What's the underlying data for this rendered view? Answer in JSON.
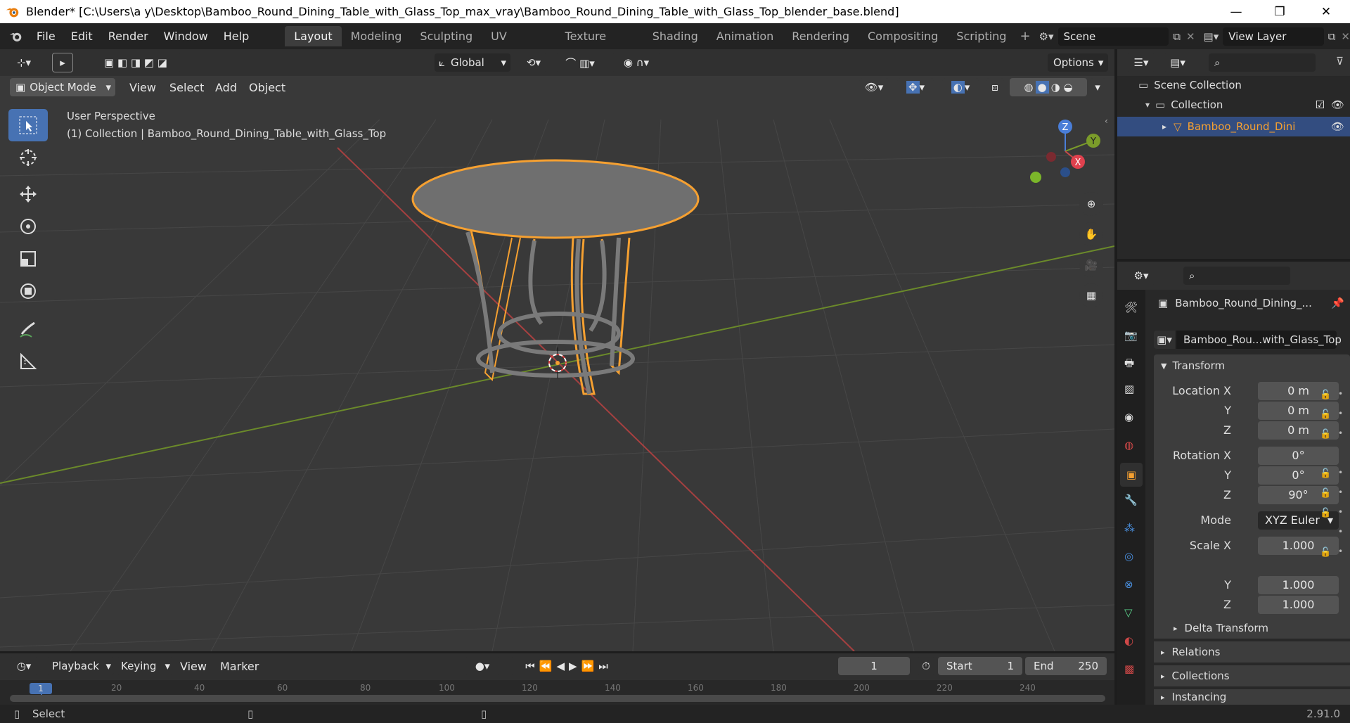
{
  "window": {
    "title": "Blender* [C:\\Users\\a y\\Desktop\\Bamboo_Round_Dining_Table_with_Glass_Top_max_vray\\Bamboo_Round_Dining_Table_with_Glass_Top_blender_base.blend]",
    "minimize": "—",
    "maximize": "❐",
    "close": "✕"
  },
  "menu": [
    "File",
    "Edit",
    "Render",
    "Window",
    "Help"
  ],
  "workspaces": [
    "Layout",
    "Modeling",
    "Sculpting",
    "UV Editing",
    "Texture Paint",
    "Shading",
    "Animation",
    "Rendering",
    "Compositing",
    "Scripting"
  ],
  "active_workspace": "Layout",
  "scene": {
    "name": "Scene",
    "view_layer": "View Layer"
  },
  "toolheader": {
    "orientation": "Global",
    "options": "Options"
  },
  "viewheader": {
    "mode": "Object Mode",
    "menus": [
      "View",
      "Select",
      "Add",
      "Object"
    ]
  },
  "viewport": {
    "perspective": "User Perspective",
    "collection_info": "(1) Collection | Bamboo_Round_Dining_Table_with_Glass_Top",
    "gizmo": {
      "x": "X",
      "y": "Y",
      "z": "Z"
    }
  },
  "outliner": {
    "root": "Scene Collection",
    "collection": "Collection",
    "object": "Bamboo_Round_Dini"
  },
  "properties": {
    "object_name": "Bamboo_Round_Dining_...",
    "mesh_name": "Bamboo_Rou...with_Glass_Top",
    "transform_title": "Transform",
    "location_label": "Location X",
    "rotation_label": "Rotation X",
    "scale_label": "Scale X",
    "axis_y": "Y",
    "axis_z": "Z",
    "location": [
      "0 m",
      "0 m",
      "0 m"
    ],
    "rotation": [
      "0°",
      "0°",
      "90°"
    ],
    "mode_label": "Mode",
    "mode_value": "XYZ Euler",
    "scale": [
      "1.000",
      "1.000",
      "1.000"
    ],
    "sections": [
      "Delta Transform",
      "Relations",
      "Collections",
      "Instancing"
    ]
  },
  "timeline": {
    "menus": [
      "Playback",
      "Keying",
      "View",
      "Marker"
    ],
    "current_frame": "1",
    "start_label": "Start",
    "start": "1",
    "end_label": "End",
    "end": "250",
    "ticks": [
      "20",
      "40",
      "60",
      "80",
      "100",
      "120",
      "140",
      "160",
      "180",
      "200",
      "220",
      "240"
    ],
    "playhead": "1"
  },
  "status": {
    "left": "Select",
    "version": "2.91.0"
  },
  "colors": {
    "accent": "#4772b3",
    "selection": "#f5a031",
    "x_axis": "#c94a4a",
    "y_axis": "#7b9c2a"
  }
}
